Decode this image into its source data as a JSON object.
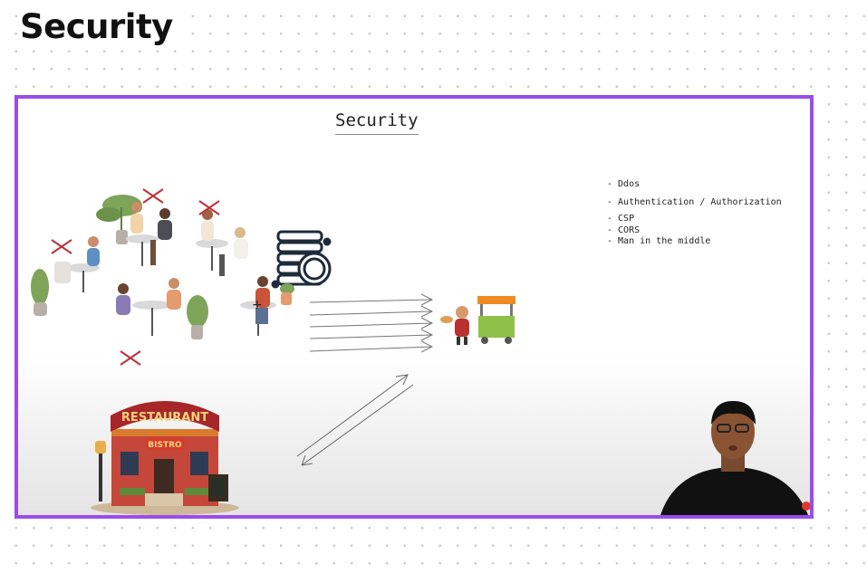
{
  "page": {
    "title": "Security"
  },
  "slide": {
    "title": "Security",
    "topics": [
      "- Ddos",
      "- Authentication / Authorization",
      "- CSP",
      "- CORS",
      "- Man in the middle"
    ],
    "restaurant_sign": "RESTAURANT",
    "bistro_sign": "BISTRO"
  },
  "colors": {
    "frame": "#9b4de8",
    "cross": "#c0303a",
    "cart_roof": "#f08a24"
  }
}
